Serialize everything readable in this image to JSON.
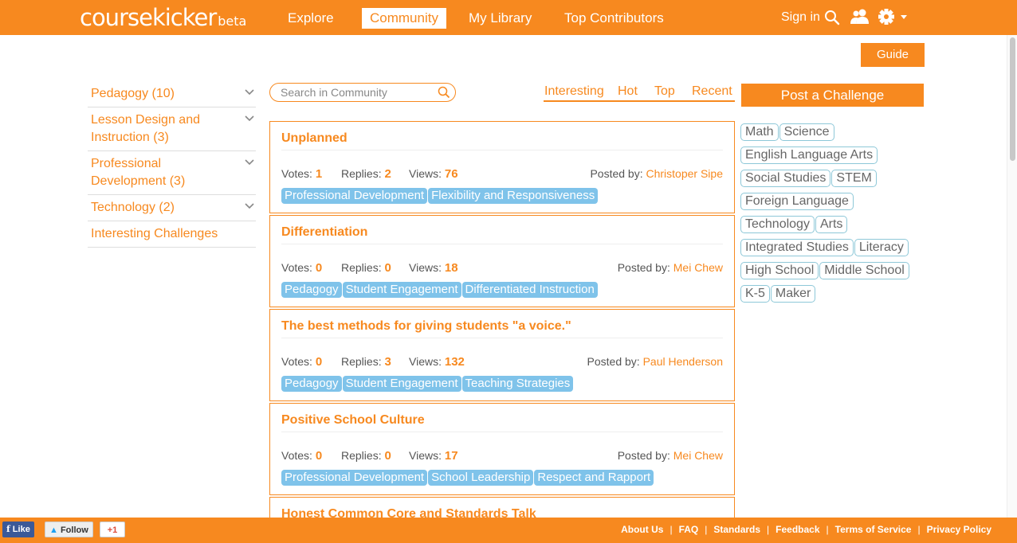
{
  "brand": {
    "name": "coursekicker",
    "suffix": "beta"
  },
  "nav": {
    "explore": "Explore",
    "community": "Community",
    "library": "My Library",
    "contributors": "Top Contributors"
  },
  "user": {
    "signin": "Sign in"
  },
  "guide_label": "Guide",
  "sidebar": [
    {
      "label": "Pedagogy (10)"
    },
    {
      "label": "Lesson Design and Instruction (3)"
    },
    {
      "label": "Professional Development (3)"
    },
    {
      "label": "Technology (2)"
    },
    {
      "label": "Interesting Challenges"
    }
  ],
  "search": {
    "placeholder": "Search in Community"
  },
  "sort_tabs": {
    "interesting": "Interesting",
    "hot": "Hot",
    "top": "Top",
    "recent": "Recent",
    "active": "Interesting"
  },
  "post_label": "Post a Challenge",
  "labels": {
    "votes": "Votes:",
    "replies": "Replies:",
    "views": "Views:",
    "posted_by": "Posted by:"
  },
  "challenges": [
    {
      "title": "Unplanned",
      "votes": "1",
      "replies": "2",
      "views": "76",
      "author": "Christoper Sipe",
      "tags": [
        "Professional Development",
        "Flexibility and Responsiveness"
      ]
    },
    {
      "title": "Differentiation",
      "votes": "0",
      "replies": "0",
      "views": "18",
      "author": "Mei Chew",
      "tags": [
        "Pedagogy",
        "Student Engagement",
        "Differentiated Instruction"
      ]
    },
    {
      "title": "The best methods for giving students \"a voice.\"",
      "votes": "0",
      "replies": "3",
      "views": "132",
      "author": "Paul Henderson",
      "tags": [
        "Pedagogy",
        "Student Engagement",
        "Teaching Strategies"
      ]
    },
    {
      "title": "Positive School Culture",
      "votes": "0",
      "replies": "0",
      "views": "17",
      "author": "Mei Chew",
      "tags": [
        "Professional Development",
        "School Leadership",
        "Respect and Rapport"
      ]
    },
    {
      "title": "Honest Common Core and Standards Talk"
    }
  ],
  "topics": [
    [
      "Math",
      "Science"
    ],
    [
      "English Language Arts"
    ],
    [
      "Social Studies",
      "STEM"
    ],
    [
      "Foreign Language"
    ],
    [
      "Technology",
      "Arts"
    ],
    [
      "Integrated Studies",
      "Literacy"
    ],
    [
      "High School",
      "Middle School"
    ],
    [
      "K-5",
      "Maker"
    ]
  ],
  "social": {
    "like": "Like",
    "follow": "Follow",
    "plus": "+1"
  },
  "footer_links": [
    "About Us",
    "FAQ",
    "Standards",
    "Feedback",
    "Terms of Service",
    "Privacy Policy"
  ],
  "colors": {
    "accent": "#f7891f",
    "tag": "#7fc3ea",
    "topic_border": "#8ec8d8"
  }
}
